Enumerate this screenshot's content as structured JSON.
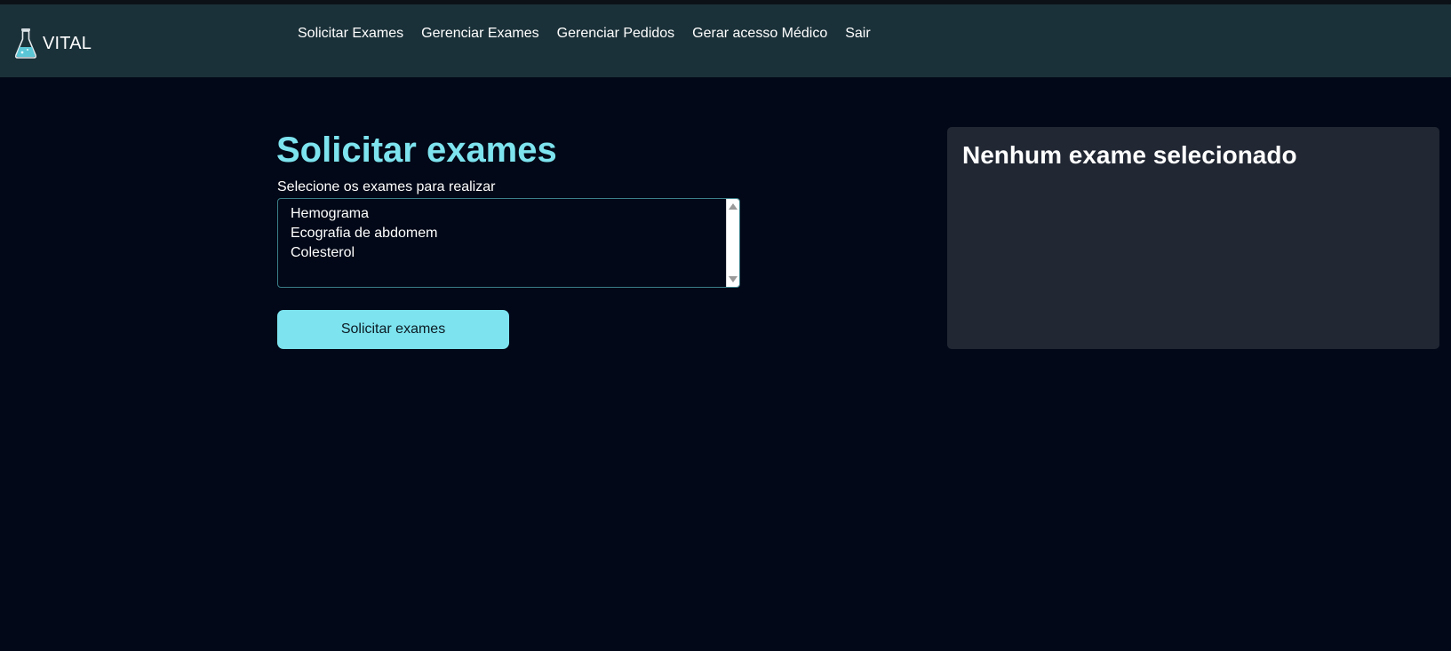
{
  "brand": {
    "name": "VITAL",
    "icon": "flask-icon"
  },
  "nav": {
    "items": [
      {
        "label": "Solicitar Exames"
      },
      {
        "label": "Gerenciar Exames"
      },
      {
        "label": "Gerenciar Pedidos"
      },
      {
        "label": "Gerar acesso Médico"
      },
      {
        "label": "Sair"
      }
    ]
  },
  "main": {
    "title": "Solicitar exames",
    "select_label": "Selecione os exames para realizar",
    "exam_options": [
      "Hemograma",
      "Ecografia de abdomem",
      "Colesterol"
    ],
    "submit_label": "Solicitar exames"
  },
  "side_panel": {
    "title": "Nenhum exame selecionado"
  },
  "colors": {
    "background": "#020817",
    "navbar": "#1b3139",
    "accent": "#7de3ee",
    "panel": "#212733"
  }
}
